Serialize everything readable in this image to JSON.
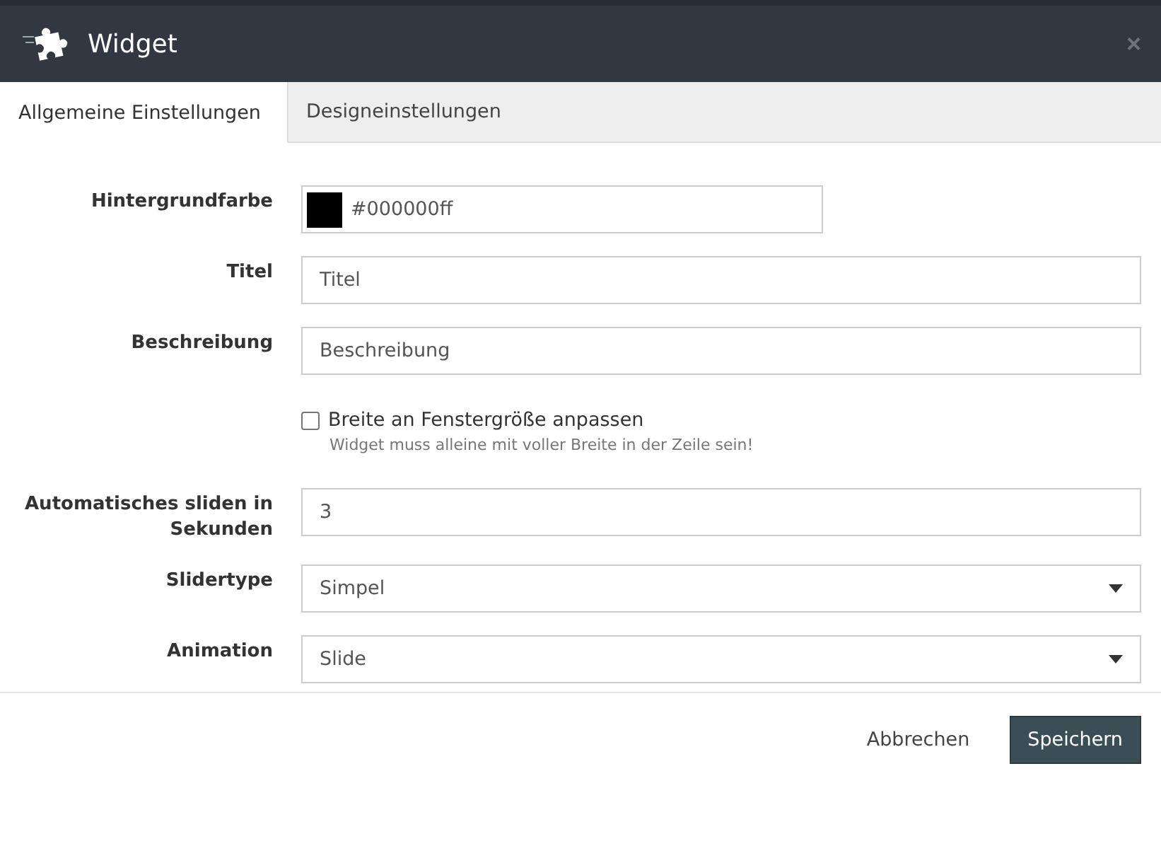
{
  "window": {
    "title": "Widget",
    "close": "×"
  },
  "tabs": [
    {
      "label": "Allgemeine Einstellungen",
      "selected": true
    },
    {
      "label": "Designeinstellungen",
      "selected": false
    }
  ],
  "fields": [
    {
      "kind": "color",
      "label": "Hintergrundfarbe",
      "value": "#000000ff",
      "color": "#000000"
    },
    {
      "kind": "text",
      "label": "Titel",
      "value": "Titel"
    },
    {
      "kind": "text",
      "label": "Beschreibung",
      "value": "Beschreibung"
    },
    {
      "kind": "checkbox",
      "label": "Breite an Fenstergröße anpassen",
      "hint": "Widget muss alleine mit voller Breite in der Zeile sein!",
      "checked": false
    },
    {
      "kind": "text",
      "label": "Automatisches sliden in Sekunden",
      "value": "3"
    },
    {
      "kind": "select",
      "label": "Slidertype",
      "value": "Simpel"
    },
    {
      "kind": "select",
      "label": "Animation",
      "value": "Slide"
    }
  ],
  "buttons": {
    "cancel": "Abbrechen",
    "save": "Speichern"
  }
}
